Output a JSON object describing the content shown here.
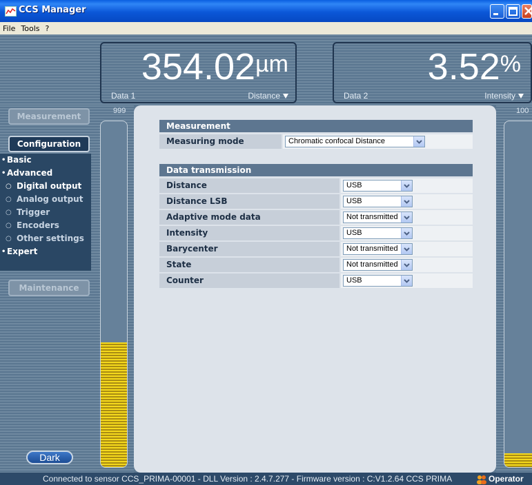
{
  "window": {
    "title": "CCS Manager"
  },
  "menu": [
    "File",
    "Tools",
    "?"
  ],
  "displays": [
    {
      "value": "354.02",
      "unit": "µm",
      "left_label": "Data 1",
      "right_label": "Distance"
    },
    {
      "value": "3.52",
      "unit": "%",
      "left_label": "Data 2",
      "right_label": "Intensity"
    }
  ],
  "gauges": {
    "left": {
      "label": "999",
      "level_fraction": 0.36
    },
    "right": {
      "label": "100",
      "level_fraction": 0.04
    }
  },
  "nav": {
    "measurement": "Measurement",
    "configuration": "Configuration",
    "maintenance": "Maintenance",
    "config_items": [
      {
        "label": "Basic",
        "bullet": "•"
      },
      {
        "label": "Advanced",
        "bullet": "•"
      },
      {
        "label": "Digital output",
        "bullet": "○"
      },
      {
        "label": "Analog output",
        "bullet": "○"
      },
      {
        "label": "Trigger",
        "bullet": "○"
      },
      {
        "label": "Encoders",
        "bullet": "○"
      },
      {
        "label": "Other settings",
        "bullet": "○"
      },
      {
        "label": "Expert",
        "bullet": "•"
      }
    ]
  },
  "dark_button": "Dark",
  "form": {
    "measurement_header": "Measurement",
    "measuring_mode_label": "Measuring mode",
    "measuring_mode_value": "Chromatic confocal Distance",
    "data_transmission_header": "Data transmission",
    "rows": [
      {
        "label": "Distance",
        "value": "USB"
      },
      {
        "label": "Distance LSB",
        "value": "USB"
      },
      {
        "label": "Adaptive mode data",
        "value": "Not transmitted"
      },
      {
        "label": "Intensity",
        "value": "USB"
      },
      {
        "label": "Barycenter",
        "value": "Not transmitted"
      },
      {
        "label": "State",
        "value": "Not transmitted"
      },
      {
        "label": "Counter",
        "value": "USB"
      }
    ]
  },
  "status": {
    "text": "Connected to sensor CCS_PRIMA-00001 - DLL Version : 2.4.7.277 - Firmware version : C:V1.2.64 CCS PRIMA",
    "user": "Operator"
  }
}
